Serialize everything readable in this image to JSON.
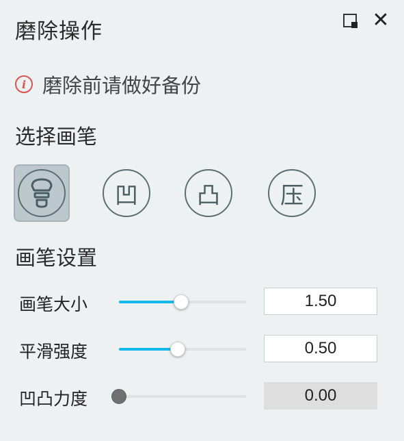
{
  "header": {
    "title": "磨除操作"
  },
  "warning": {
    "text": "磨除前请做好备份"
  },
  "brush_section": {
    "title": "选择画笔",
    "brushes": [
      {
        "name": "grind-brush",
        "glyph": "⛉",
        "selected": true
      },
      {
        "name": "concave-brush",
        "glyph": "凹",
        "selected": false
      },
      {
        "name": "convex-brush",
        "glyph": "凸",
        "selected": false
      },
      {
        "name": "press-brush",
        "glyph": "压",
        "selected": false
      }
    ]
  },
  "settings_section": {
    "title": "画笔设置",
    "rows": [
      {
        "label": "画笔大小",
        "value": "1.50",
        "fraction": 0.49,
        "enabled": true
      },
      {
        "label": "平滑强度",
        "value": "0.50",
        "fraction": 0.46,
        "enabled": true
      },
      {
        "label": "凹凸力度",
        "value": "0.00",
        "fraction": 0.0,
        "enabled": false
      }
    ]
  },
  "colors": {
    "accent": "#15b7ef",
    "warning": "#d9534f",
    "background": "#eef1f2"
  }
}
